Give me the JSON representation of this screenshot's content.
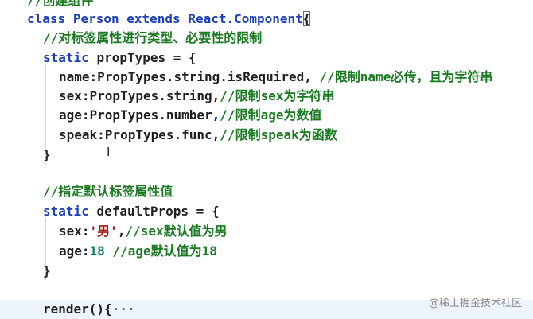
{
  "lines": {
    "l0": {
      "cmt": "//创建组件"
    },
    "l1": {
      "kw1": "class",
      "name": "Person",
      "kw2": "extends",
      "base": "React.Component",
      "brace": "{"
    },
    "l2": {
      "cmt": "//对标签属性进行类型、必要性的限制"
    },
    "l3": {
      "kw": "static",
      "name": "propTypes",
      "op": "=",
      "brace": "{"
    },
    "l4": {
      "code": "name:PropTypes.string.isRequired,",
      "cmt": "//限制name必传，且为字符串"
    },
    "l5": {
      "code": "sex:PropTypes.string,",
      "cmt": "//限制sex为字符串"
    },
    "l6": {
      "code": "age:PropTypes.number,",
      "cmt": "//限制age为数值"
    },
    "l7": {
      "code": "speak:PropTypes.func,",
      "cmt": "//限制speak为函数"
    },
    "l8": {
      "brace": "}"
    },
    "l9": {
      "cmt": "//指定默认标签属性值"
    },
    "l10": {
      "kw": "static",
      "name": "defaultProps",
      "op": "=",
      "brace": "{"
    },
    "l11": {
      "key": "sex:",
      "str": "'男'",
      "punc": ",",
      "cmt": "//sex默认值为男"
    },
    "l12": {
      "key": "age:",
      "num": "18",
      "cmt": "//age默认值为18"
    },
    "l13": {
      "brace": "}"
    },
    "l14": {
      "code": "render(){",
      "fold": "···"
    }
  },
  "cursor_glyph": "I",
  "watermark": "@稀土掘金技术社区",
  "colors": {
    "keyword": "#1d3fb8",
    "comment": "#1a7a22",
    "string": "#a31515",
    "number": "#0a7e5d",
    "text": "#1f1f1f"
  }
}
